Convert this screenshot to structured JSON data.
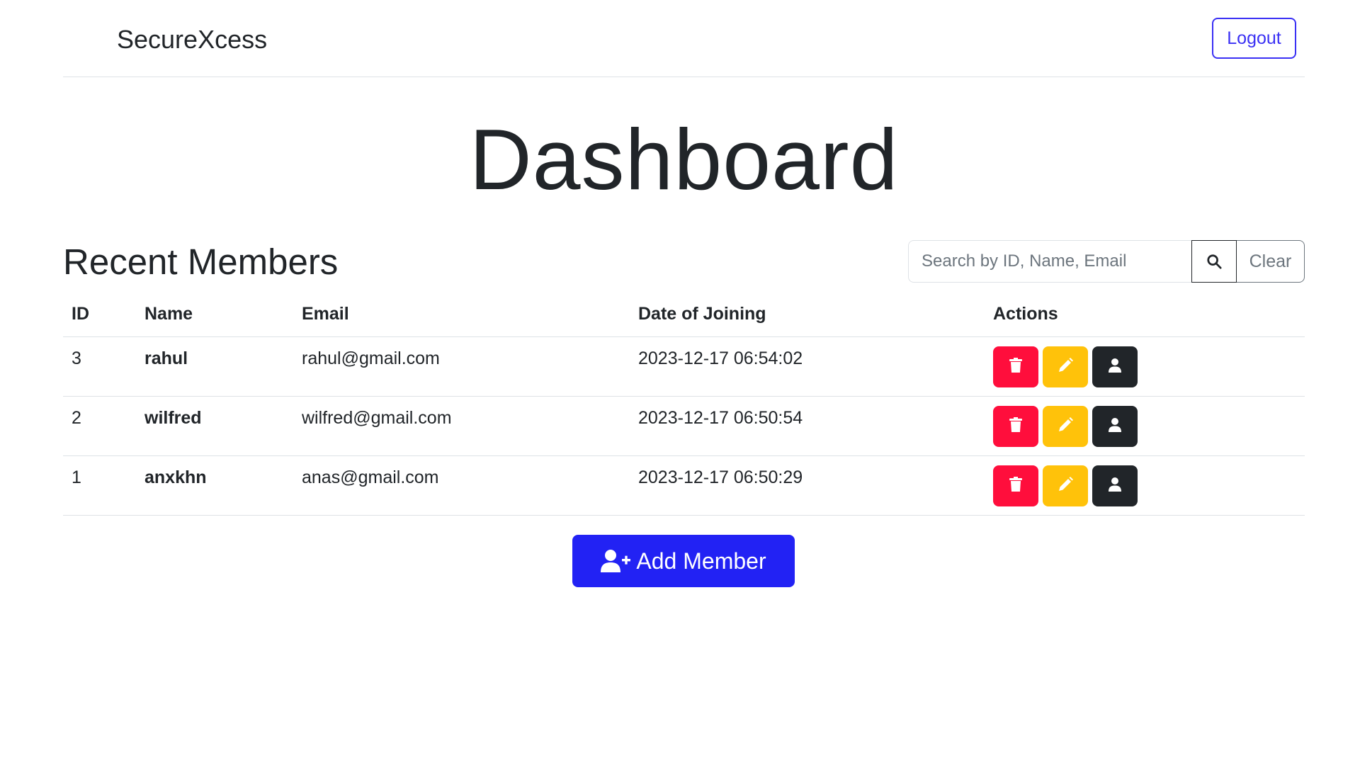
{
  "navbar": {
    "brand": "SecureXcess",
    "logout_label": "Logout"
  },
  "page": {
    "title": "Dashboard"
  },
  "section": {
    "title": "Recent Members"
  },
  "search": {
    "placeholder": "Search by ID, Name, Email",
    "value": "",
    "clear_label": "Clear",
    "icon": "search-icon"
  },
  "table": {
    "headers": {
      "id": "ID",
      "name": "Name",
      "email": "Email",
      "date": "Date of Joining",
      "actions": "Actions"
    },
    "rows": [
      {
        "id": "3",
        "name": "rahul",
        "email": "rahul@gmail.com",
        "date": "2023-12-17 06:54:02"
      },
      {
        "id": "2",
        "name": "wilfred",
        "email": "wilfred@gmail.com",
        "date": "2023-12-17 06:50:54"
      },
      {
        "id": "1",
        "name": "anxkhn",
        "email": "anas@gmail.com",
        "date": "2023-12-17 06:50:29"
      }
    ],
    "action_icons": [
      "trash-icon",
      "pencil-icon",
      "user-icon"
    ]
  },
  "add_member": {
    "label": "Add Member",
    "icon": "user-plus-icon"
  },
  "colors": {
    "primary": "#2222f4",
    "logout": "#3a30f4",
    "delete": "#ff0e3c",
    "edit": "#ffc20a",
    "view": "#212529"
  }
}
